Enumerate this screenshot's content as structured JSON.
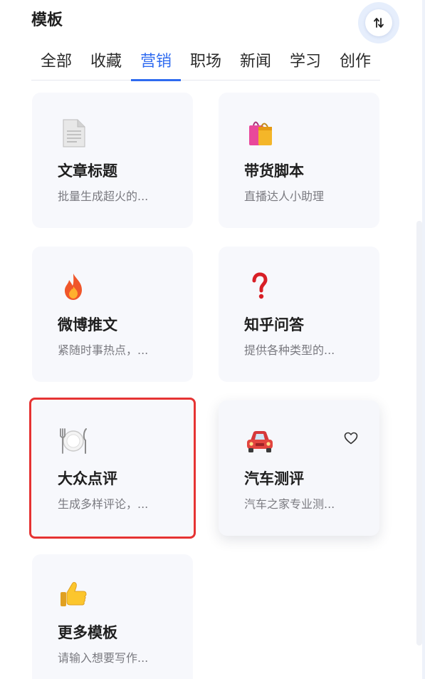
{
  "header": {
    "title": "模板"
  },
  "sort_button": {
    "icon": "sort-arrows-icon"
  },
  "tabs": [
    {
      "label": "全部",
      "active": false
    },
    {
      "label": "收藏",
      "active": false
    },
    {
      "label": "营销",
      "active": true
    },
    {
      "label": "职场",
      "active": false
    },
    {
      "label": "新闻",
      "active": false
    },
    {
      "label": "学习",
      "active": false
    },
    {
      "label": "创作",
      "active": false
    }
  ],
  "cards": [
    {
      "title": "文章标题",
      "desc": "批量生成超火的...",
      "icon": "document-icon"
    },
    {
      "title": "带货脚本",
      "desc": "直播达人小助理",
      "icon": "shopping-bags-icon"
    },
    {
      "title": "微博推文",
      "desc": "紧随时事热点，...",
      "icon": "fire-icon"
    },
    {
      "title": "知乎问答",
      "desc": "提供各种类型的...",
      "icon": "question-mark-icon"
    },
    {
      "title": "大众点评",
      "desc": "生成多样评论，...",
      "icon": "plate-cutlery-icon",
      "selected": true
    },
    {
      "title": "汽车测评",
      "desc": "汽车之家专业测...",
      "icon": "car-icon",
      "hovered": true
    },
    {
      "title": "更多模板",
      "desc": "请输入想要写作...",
      "icon": "thumbs-up-icon"
    }
  ],
  "colors": {
    "accent": "#2f6bf0",
    "selection": "#e53333",
    "card_bg": "#f7f8fc"
  }
}
